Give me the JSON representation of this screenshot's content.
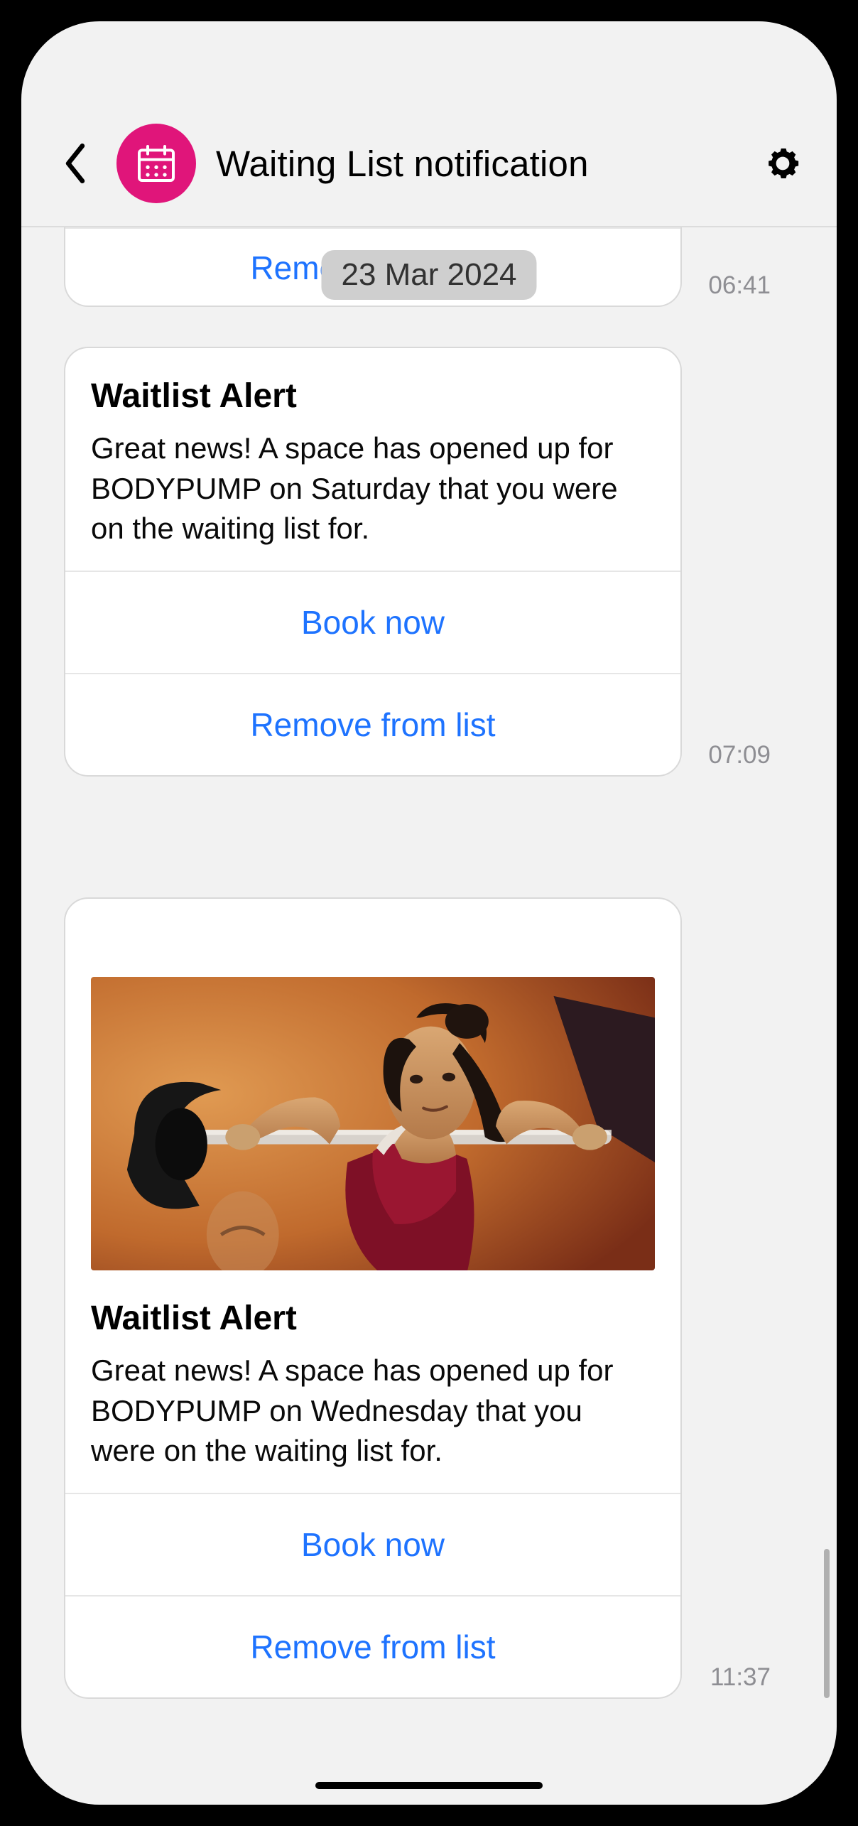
{
  "header": {
    "title": "Waiting List notification"
  },
  "datePill": "23 Mar 2024",
  "messages": {
    "m0": {
      "removeLabel": "Remove from list",
      "time": "06:41"
    },
    "m1": {
      "title": "Waitlist Alert",
      "body": "Great news! A space has opened up for BODYPUMP on Saturday that you were on the waiting list for.",
      "bookLabel": "Book now",
      "removeLabel": "Remove from list",
      "time": "07:09"
    },
    "m2": {
      "title": "Waitlist Alert",
      "body": "Great news! A space has opened up for BODYPUMP on Wednesday that you were on the waiting list for.",
      "bookLabel": "Book now",
      "removeLabel": "Remove from list",
      "time": "11:37"
    }
  }
}
